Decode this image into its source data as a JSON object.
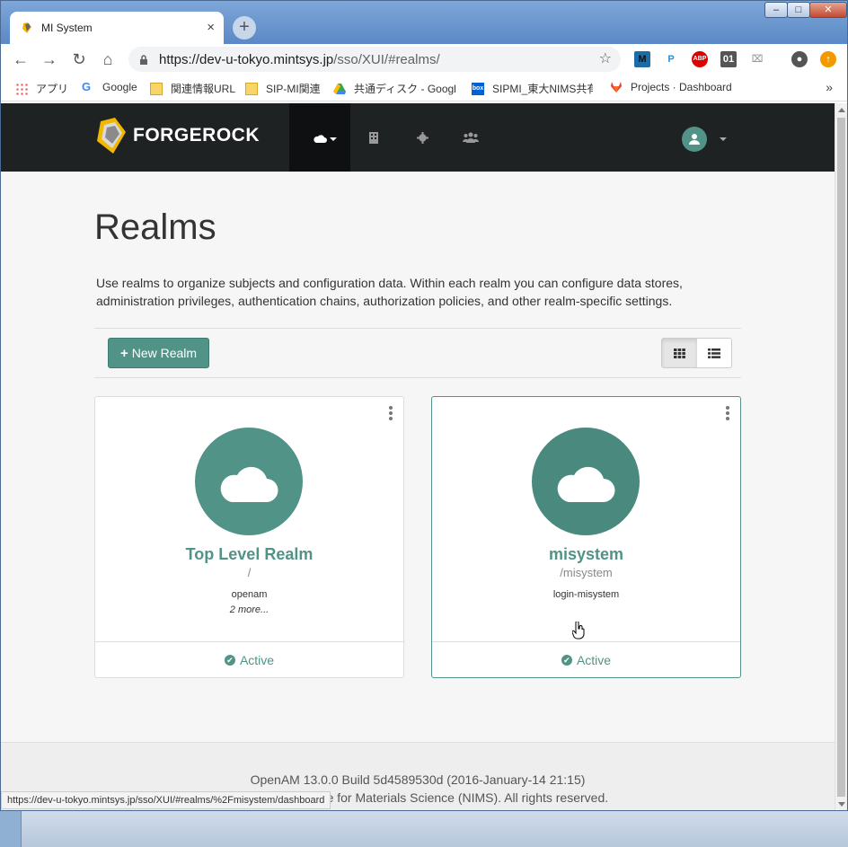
{
  "browser": {
    "tab_title": "MI System",
    "tab_close": "×",
    "new_tab": "+",
    "url_host": "https://dev-u-tokyo.mintsys.jp",
    "url_path": "/sso/XUI/#realms/",
    "status_url": "https://dev-u-tokyo.mintsys.jp/sso/XUI/#realms/%2Fmisystem/dashboard",
    "window_controls": {
      "min": "–",
      "max": "□",
      "close": "✕"
    },
    "extensions": [
      "M",
      "P",
      "ABP",
      "01"
    ],
    "bookmarks": [
      {
        "label": "アプリ",
        "icon": "apps-grid-icon"
      },
      {
        "label": "Google",
        "icon": "google-icon"
      },
      {
        "label": "関連情報URL",
        "icon": "folder-icon"
      },
      {
        "label": "SIP-MI関連",
        "icon": "folder-icon"
      },
      {
        "label": "共通ディスク - Google",
        "icon": "drive-icon"
      },
      {
        "label": "SIPMI_東大NIMS共有",
        "icon": "box-icon"
      },
      {
        "label": "Projects · Dashboard",
        "icon": "gitlab-icon"
      }
    ],
    "bookmarks_more": "»"
  },
  "app": {
    "brand": "FORGEROCK",
    "title": "Realms",
    "description": "Use realms to organize subjects and configuration data. Within each realm you can configure data stores, administration privileges, authentication chains, authorization policies, and other realm-specific settings.",
    "new_realm_label": "New Realm",
    "realms": [
      {
        "name": "Top Level Realm",
        "path": "/",
        "alias": "openam",
        "more": "2 more...",
        "status": "Active"
      },
      {
        "name": "misystem",
        "path": "/misystem",
        "alias": "login-misystem",
        "more": "",
        "status": "Active"
      }
    ],
    "footer_line1": "OpenAM 13.0.0 Build 5d4589530d (2016-January-14 21:15)",
    "footer_line2": "© National Institute for Materials Science (NIMS). All rights reserved."
  },
  "colors": {
    "accent": "#519387",
    "navbar": "#1f2223"
  }
}
